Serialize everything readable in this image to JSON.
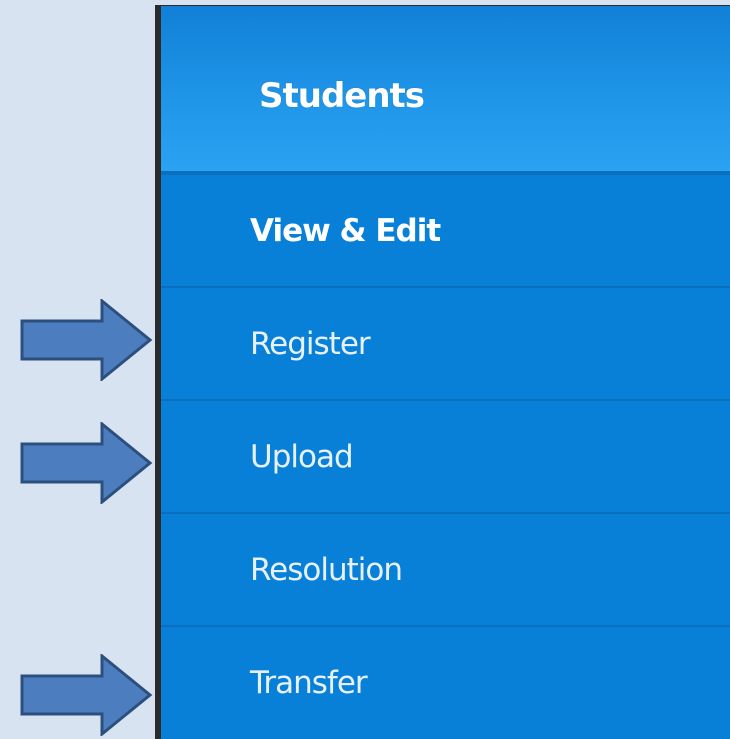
{
  "menu": {
    "header": "Students",
    "items": [
      {
        "label": "View & Edit",
        "active": true
      },
      {
        "label": "Register",
        "active": false
      },
      {
        "label": "Upload",
        "active": false
      },
      {
        "label": "Resolution",
        "active": false
      },
      {
        "label": "Transfer",
        "active": false
      }
    ]
  },
  "annotations": {
    "arrows": [
      {
        "points_to": "Register",
        "icon": "right-arrow-icon"
      },
      {
        "points_to": "Upload",
        "icon": "right-arrow-icon"
      },
      {
        "points_to": "Transfer",
        "icon": "right-arrow-icon"
      }
    ],
    "arrow_fill": "#4c7ebf",
    "arrow_stroke": "#2d4f7e"
  },
  "colors": {
    "background": "#d7e3f0",
    "menu_bg": "#0880d8",
    "header_bg_light": "#2aa2f2",
    "divider": "#0b6fbd",
    "text": "#ffffff"
  }
}
